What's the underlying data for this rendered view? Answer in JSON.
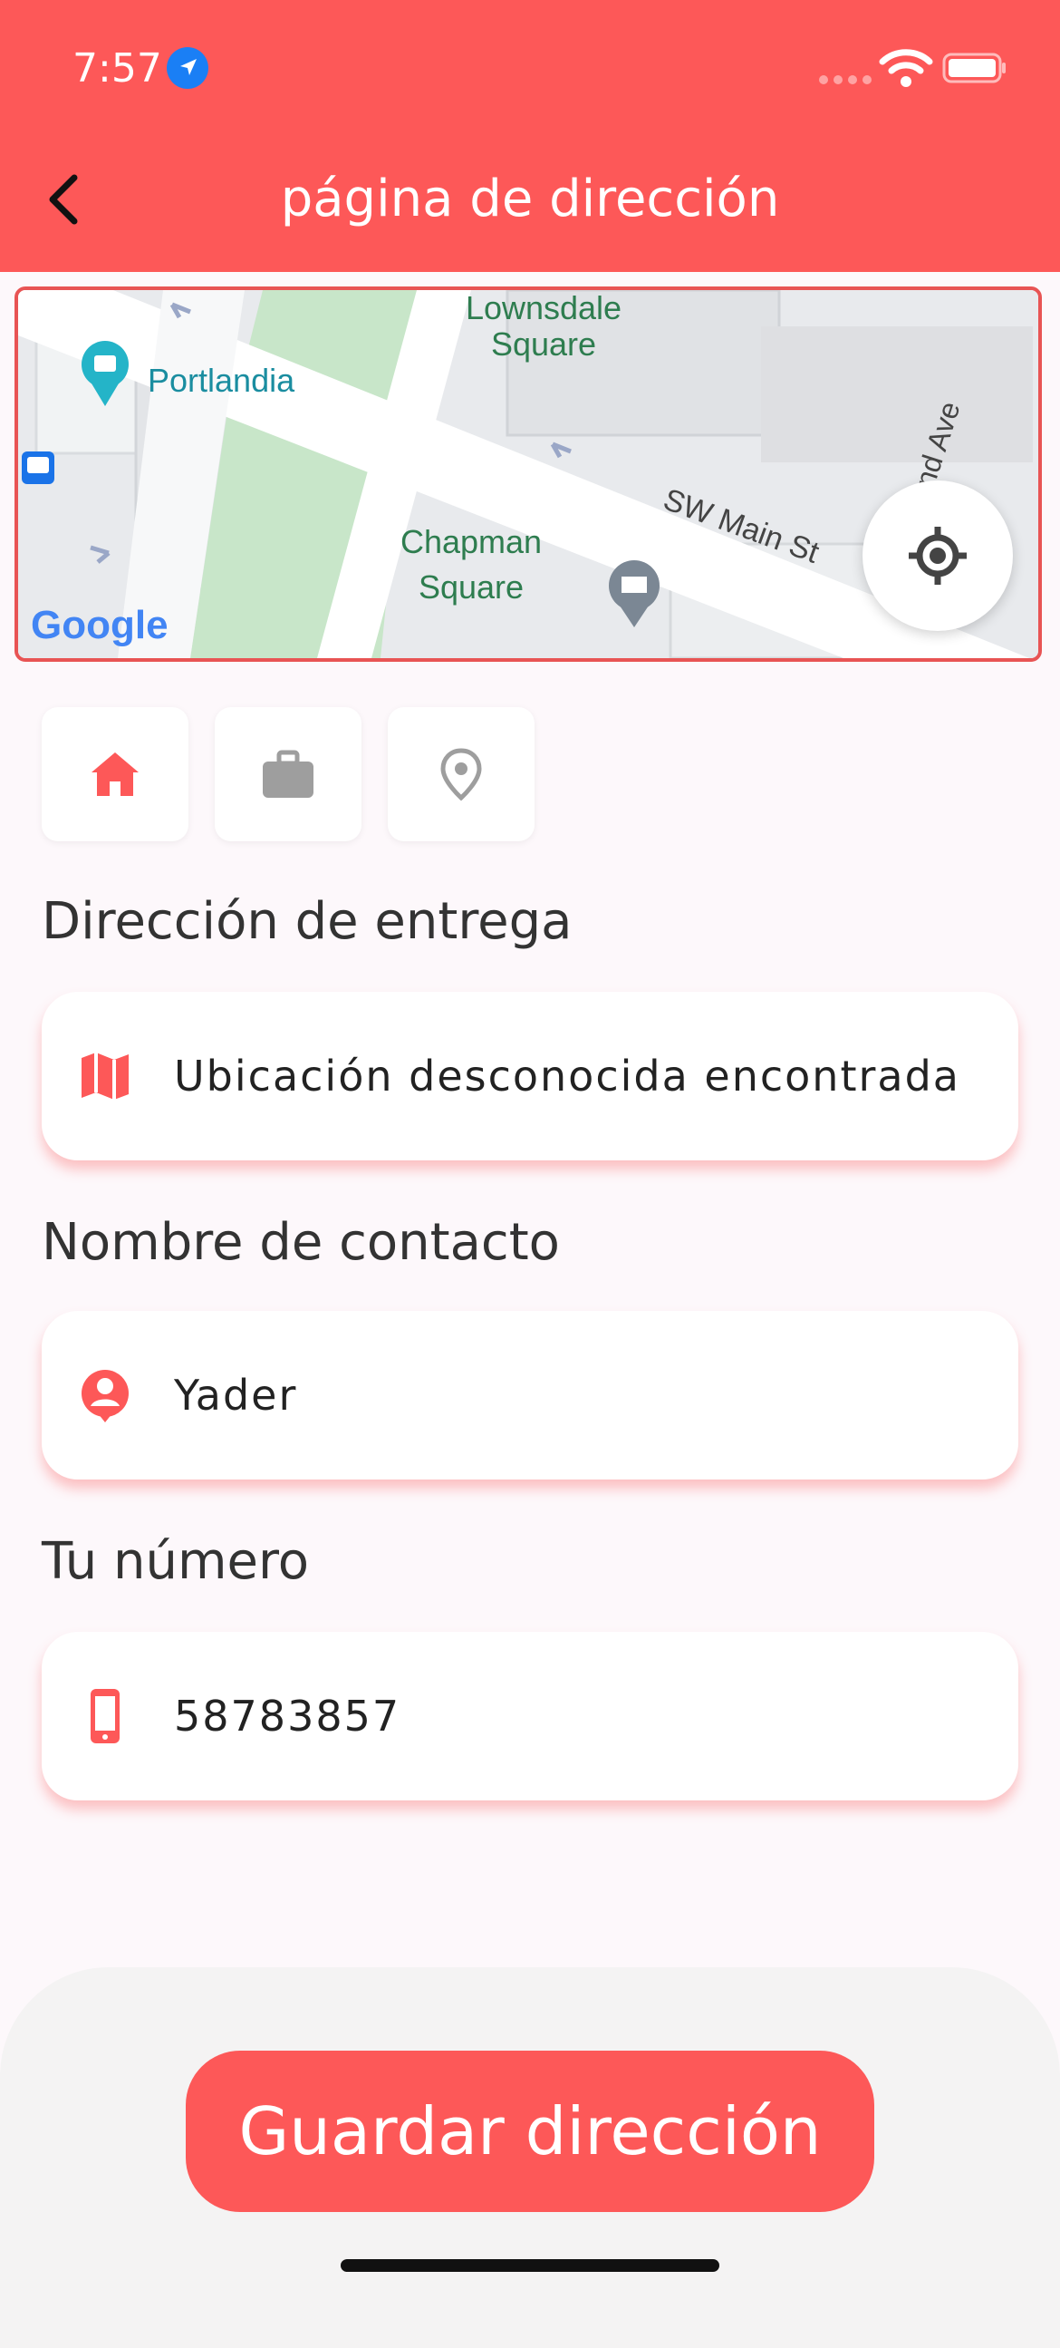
{
  "status_bar": {
    "time": "7:57"
  },
  "header": {
    "title": "página de dirección"
  },
  "map": {
    "labels": {
      "lownsdale": "Lownsdale",
      "lownsdale2": "Square",
      "portlandia": "Portlandia",
      "chapman": "Chapman",
      "chapman2": "Square",
      "main_st": "SW Main St",
      "ave": "nd Ave",
      "google": "Google"
    }
  },
  "address_types": [
    {
      "name": "home",
      "active": true
    },
    {
      "name": "work",
      "active": false
    },
    {
      "name": "other",
      "active": false
    }
  ],
  "form": {
    "delivery_label": "Dirección de entrega",
    "delivery_value": "Ubicación desconocida encontrada",
    "contact_label": "Nombre de contacto",
    "contact_value": "Yader",
    "phone_label": "Tu número",
    "phone_value": "58783857"
  },
  "save_button": {
    "label": "Guardar dirección"
  },
  "colors": {
    "accent": "#fd5858",
    "icon_gray": "#9e9e9e",
    "park": "#c8e6c9"
  }
}
